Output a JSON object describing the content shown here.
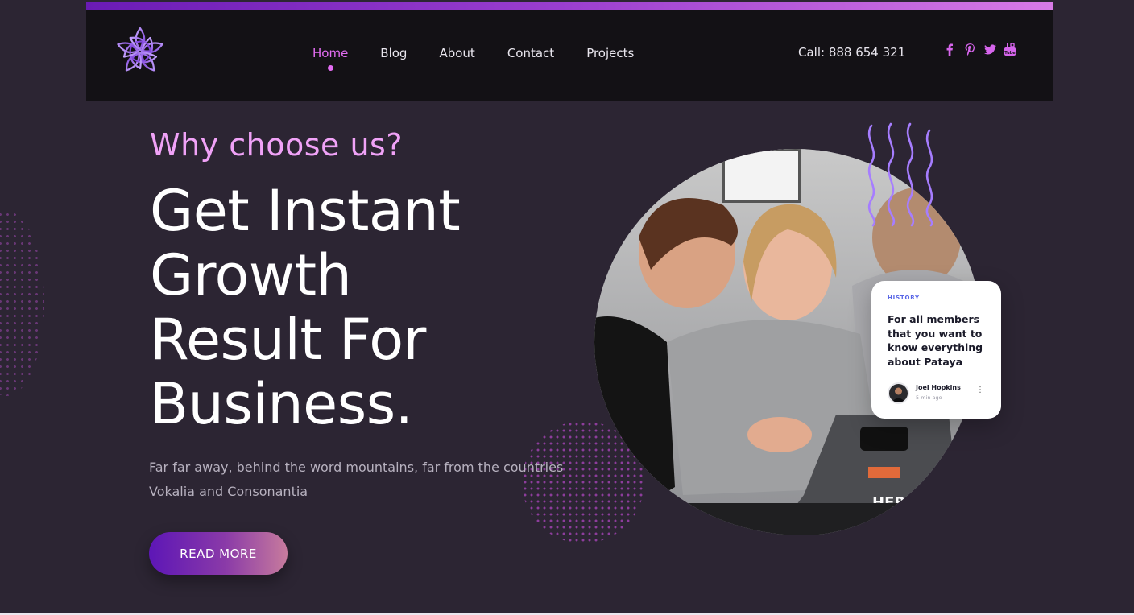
{
  "header": {
    "nav": [
      {
        "label": "Home",
        "active": true
      },
      {
        "label": "Blog",
        "active": false
      },
      {
        "label": "About",
        "active": false
      },
      {
        "label": "Contact",
        "active": false
      },
      {
        "label": "Projects",
        "active": false
      }
    ],
    "call_text": "Call: 888 654 321",
    "socials": [
      "facebook-icon",
      "pinterest-icon",
      "twitter-icon",
      "youtube-icon"
    ]
  },
  "hero": {
    "kicker": "Why choose us?",
    "headline_lines": [
      "Get Instant",
      "Growth",
      "Result For",
      "Business."
    ],
    "description": "Far far away, behind the word mountains, far from the countries Vokalia and Consonantia",
    "button_label": "READ MORE"
  },
  "card": {
    "tag": "HISTORY",
    "title": "For all members that you want to know everything about Pataya",
    "author": "Joel Hopkins",
    "time": "5 min ago"
  },
  "colors": {
    "accent": "#e36cf2",
    "background": "#2c2533",
    "header_bg": "#131115",
    "button_start": "#5d16b6",
    "button_end": "#c77b9d"
  }
}
